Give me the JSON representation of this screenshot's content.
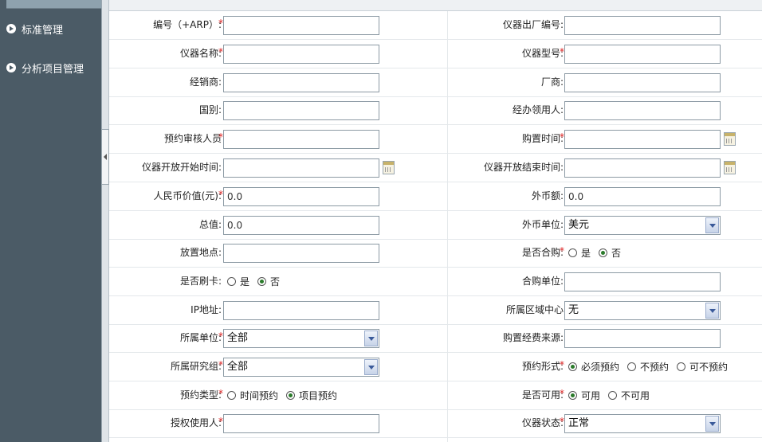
{
  "sidebar": {
    "items": [
      {
        "label": "标准管理"
      },
      {
        "label": "分析项目管理"
      }
    ]
  },
  "form": {
    "rows": [
      {
        "left": {
          "label": "编号（+ARP）:",
          "required": true,
          "type": "text",
          "value": ""
        },
        "right": {
          "label": "仪器出厂编号:",
          "required": false,
          "type": "text",
          "value": ""
        }
      },
      {
        "left": {
          "label": "仪器名称:",
          "required": true,
          "type": "text",
          "value": ""
        },
        "right": {
          "label": "仪器型号:",
          "required": true,
          "type": "text",
          "value": ""
        }
      },
      {
        "left": {
          "label": "经销商:",
          "required": false,
          "type": "text",
          "value": ""
        },
        "right": {
          "label": "厂商:",
          "required": false,
          "type": "text",
          "value": ""
        }
      },
      {
        "left": {
          "label": "国别:",
          "required": false,
          "type": "text",
          "value": ""
        },
        "right": {
          "label": "经办领用人:",
          "required": false,
          "type": "text",
          "value": ""
        }
      },
      {
        "left": {
          "label": "预约审核人员",
          "required": true,
          "type": "text",
          "value": ""
        },
        "right": {
          "label": "购置时间:",
          "required": true,
          "type": "date",
          "value": ""
        }
      },
      {
        "left": {
          "label": "仪器开放开始时间:",
          "required": false,
          "type": "date",
          "value": ""
        },
        "right": {
          "label": "仪器开放结束时间:",
          "required": false,
          "type": "date",
          "value": ""
        }
      },
      {
        "left": {
          "label": "人民币价值(元):",
          "required": true,
          "type": "text",
          "value": "0.0"
        },
        "right": {
          "label": "外币额:",
          "required": false,
          "type": "text",
          "value": "0.0"
        }
      },
      {
        "left": {
          "label": "总值:",
          "required": false,
          "type": "text",
          "value": "0.0"
        },
        "right": {
          "label": "外币单位:",
          "required": false,
          "type": "select",
          "value": "美元"
        }
      },
      {
        "left": {
          "label": "放置地点:",
          "required": false,
          "type": "text",
          "value": ""
        },
        "right": {
          "label": "是否合购:",
          "required": true,
          "type": "radio",
          "options": [
            "是",
            "否"
          ],
          "selected": 1
        }
      },
      {
        "left": {
          "label": "是否刷卡:",
          "required": false,
          "type": "radio",
          "options": [
            "是",
            "否"
          ],
          "selected": 1
        },
        "right": {
          "label": "合购单位:",
          "required": false,
          "type": "text",
          "value": ""
        }
      },
      {
        "left": {
          "label": "IP地址:",
          "required": false,
          "type": "text",
          "value": ""
        },
        "right": {
          "label": "所属区域中心",
          "required": false,
          "type": "select",
          "value": "无"
        }
      },
      {
        "left": {
          "label": "所属单位:",
          "required": true,
          "type": "select",
          "value": "全部"
        },
        "right": {
          "label": "购置经费来源:",
          "required": false,
          "type": "text",
          "value": ""
        }
      },
      {
        "left": {
          "label": "所属研究组:",
          "required": true,
          "type": "select",
          "value": "全部"
        },
        "right": {
          "label": "预约形式:",
          "required": true,
          "type": "radio",
          "options": [
            "必须预约",
            "不预约",
            "可不预约"
          ],
          "selected": 0
        }
      },
      {
        "left": {
          "label": "预约类型:",
          "required": true,
          "type": "radio",
          "options": [
            "时间预约",
            "项目预约"
          ],
          "selected": 1
        },
        "right": {
          "label": "是否可用:",
          "required": true,
          "type": "radio",
          "options": [
            "可用",
            "不可用"
          ],
          "selected": 0
        }
      },
      {
        "left": {
          "label": "授权使用人:",
          "required": true,
          "type": "text",
          "value": ""
        },
        "right": {
          "label": "仪器状态:",
          "required": true,
          "type": "select",
          "value": "正常"
        }
      }
    ]
  }
}
